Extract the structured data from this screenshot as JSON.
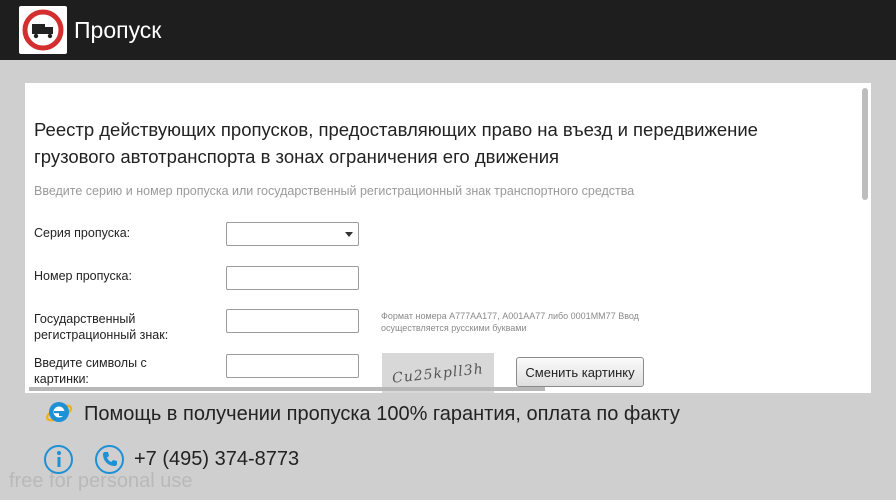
{
  "app": {
    "title": "Пропуск"
  },
  "form": {
    "heading": "Реестр действующих пропусков, предоставляющих право на въезд и передвижение грузового автотранспорта в зонах ограничения его движения",
    "hint": "Введите серию и номер пропуска или государственный регистрационный знак транспортного средства",
    "series_label": "Серия пропуска:",
    "series_value": "",
    "number_label": "Номер пропуска:",
    "number_value": "",
    "plate_label": "Государственный регистрационный знак:",
    "plate_value": "",
    "plate_format_hint": "Формат номера А777АА177, А001АА77 либо 0001ММ77 Ввод осуществляется русскими буквами",
    "captcha_label": "Введите символы с картинки:",
    "captcha_value": "",
    "captcha_text": "Cu25kpll3h",
    "change_image_label": "Сменить картинку"
  },
  "footer": {
    "promo_text": "Помощь в получении пропуска 100% гарантия, оплата по факту",
    "phone": "+7 (495) 374-8773",
    "watermark": "free for personal use"
  },
  "colors": {
    "appbar": "#1e1e1e",
    "accent": "#1e90d6",
    "sign_red": "#d32f2f"
  },
  "icons": [
    "no-trucks-sign-icon",
    "internet-explorer-icon",
    "info-icon",
    "phone-icon",
    "dropdown-arrow-icon"
  ]
}
